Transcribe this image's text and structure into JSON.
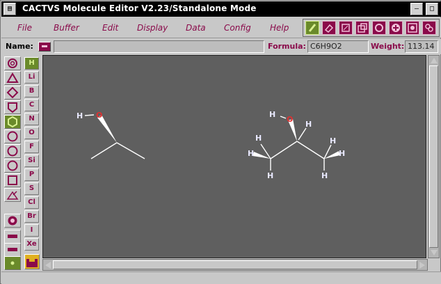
{
  "window": {
    "title": "CACTVS Molecule Editor V2.23/Standalone Mode",
    "menu_glyph": "▤",
    "minimize_glyph": "—",
    "maximize_glyph": "□"
  },
  "menu": {
    "items": [
      "File",
      "Buffer",
      "Edit",
      "Display",
      "Data",
      "Config",
      "Help"
    ]
  },
  "toolbar": {
    "tools": [
      "pencil-icon",
      "eraser-icon",
      "select-box-icon",
      "zoom-icon",
      "rotate-icon",
      "add-icon",
      "gear-icon",
      "template-icon"
    ],
    "active_tool": "pencil-icon"
  },
  "info": {
    "name_label": "Name:",
    "name_value": "",
    "formula_label": "Formula:",
    "formula_value": "C6H9O2",
    "weight_label": "Weight:",
    "weight_value": "113.14"
  },
  "shapes": [
    "spiral-icon",
    "triangle-icon",
    "diamond-icon",
    "pentagon-icon",
    "hexagon-icon",
    "heptagon-icon",
    "octagon-icon",
    "circle-icon",
    "square-icon",
    "ring-edit-icon",
    "charge-icon",
    "bond-single-icon",
    "bond-double-icon",
    "dot-icon"
  ],
  "elements": [
    "H",
    "Li",
    "B",
    "C",
    "N",
    "O",
    "F",
    "Si",
    "P",
    "S",
    "Cl",
    "Br",
    "I",
    "Xe"
  ],
  "active_element": "H",
  "molecule1": {
    "atoms": [
      {
        "label": "H",
        "color": "#e8e8ff"
      },
      {
        "label": "O",
        "color": "#e03030"
      }
    ]
  },
  "molecule2": {
    "atoms": [
      {
        "label": "H",
        "color": "#e8e8ff"
      },
      {
        "label": "O",
        "color": "#e03030"
      },
      {
        "label": "H",
        "color": "#e8e8ff"
      },
      {
        "label": "H",
        "color": "#e8e8ff"
      },
      {
        "label": "H",
        "color": "#e8e8ff"
      },
      {
        "label": "H",
        "color": "#e8e8ff"
      },
      {
        "label": "H",
        "color": "#e8e8ff"
      },
      {
        "label": "H",
        "color": "#e8e8ff"
      },
      {
        "label": "H",
        "color": "#e8e8ff"
      }
    ]
  },
  "colors": {
    "accent": "#8a0a4a",
    "active": "#6a8a2a",
    "canvas": "#5f5f5f",
    "bond": "#ffffff",
    "oxygen": "#e03030"
  }
}
